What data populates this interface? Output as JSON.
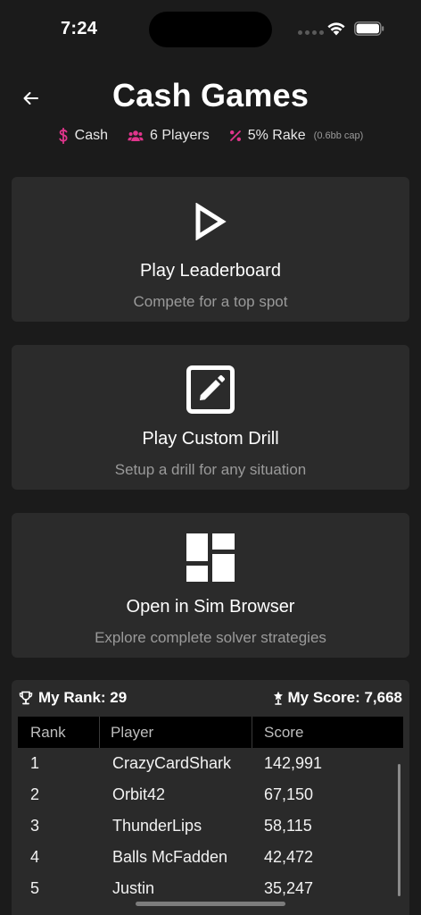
{
  "status_bar": {
    "time": "7:24"
  },
  "header": {
    "title": "Cash Games",
    "meta": [
      {
        "icon": "dollar-icon",
        "label": "Cash"
      },
      {
        "icon": "players-icon",
        "label": "6 Players"
      },
      {
        "icon": "percent-icon",
        "label": "5% Rake",
        "note": "(0.6bb cap)"
      }
    ]
  },
  "cards": [
    {
      "icon": "play-icon",
      "title": "Play Leaderboard",
      "subtitle": "Compete for a top spot"
    },
    {
      "icon": "edit-icon",
      "title": "Play Custom Drill",
      "subtitle": "Setup a drill for any situation"
    },
    {
      "icon": "dashboard-icon",
      "title": "Open in Sim Browser",
      "subtitle": "Explore complete solver strategies"
    }
  ],
  "leaderboard": {
    "my_rank_label": "My Rank: 29",
    "my_score_label": "My Score: 7,668",
    "columns": [
      "Rank",
      "Player",
      "Score"
    ],
    "rows": [
      {
        "rank": "1",
        "player": "CrazyCardShark",
        "score": "142,991"
      },
      {
        "rank": "2",
        "player": "Orbit42",
        "score": "67,150"
      },
      {
        "rank": "3",
        "player": "ThunderLips",
        "score": "58,115"
      },
      {
        "rank": "4",
        "player": "Balls McFadden",
        "score": "42,472"
      },
      {
        "rank": "5",
        "player": "Justin",
        "score": "35,247"
      }
    ]
  },
  "colors": {
    "accent": "#e0358c",
    "background": "#1b1b1b",
    "card": "#2b2b2b",
    "table_header": "#000000"
  }
}
